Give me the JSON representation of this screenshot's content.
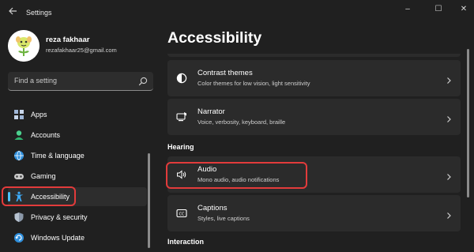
{
  "window": {
    "title": "Settings",
    "controls": {
      "minimize": "–",
      "maximize": "☐",
      "close": "✕"
    }
  },
  "user": {
    "name": "reza fakhaar",
    "email": "rezafakhaar25@gmail.com"
  },
  "search": {
    "placeholder": "Find a setting"
  },
  "sidebar": {
    "items": [
      {
        "label": "Apps",
        "icon": "apps-icon",
        "selected": false
      },
      {
        "label": "Accounts",
        "icon": "accounts-icon",
        "selected": false
      },
      {
        "label": "Time & language",
        "icon": "time-language-icon",
        "selected": false
      },
      {
        "label": "Gaming",
        "icon": "gaming-icon",
        "selected": false
      },
      {
        "label": "Accessibility",
        "icon": "accessibility-icon",
        "selected": true
      },
      {
        "label": "Privacy & security",
        "icon": "shield-icon",
        "selected": false
      },
      {
        "label": "Windows Update",
        "icon": "windows-update-icon",
        "selected": false
      }
    ]
  },
  "main": {
    "title": "Accessibility",
    "cards": {
      "contrast": {
        "title": "Contrast themes",
        "subtitle": "Color themes for low vision, light sensitivity",
        "icon": "contrast-icon"
      },
      "narrator": {
        "title": "Narrator",
        "subtitle": "Voice, verbosity, keyboard, braille",
        "icon": "narrator-icon"
      },
      "audio": {
        "title": "Audio",
        "subtitle": "Mono audio, audio notifications",
        "icon": "speaker-icon"
      },
      "captions": {
        "title": "Captions",
        "subtitle": "Styles, live captions",
        "icon": "captions-icon"
      }
    },
    "sections": {
      "hearing": "Hearing",
      "interaction": "Interaction"
    }
  },
  "colors": {
    "background": "#202020",
    "card": "#2b2b2b",
    "accent": "#4cc2ff",
    "highlight": "#e23b3b"
  }
}
